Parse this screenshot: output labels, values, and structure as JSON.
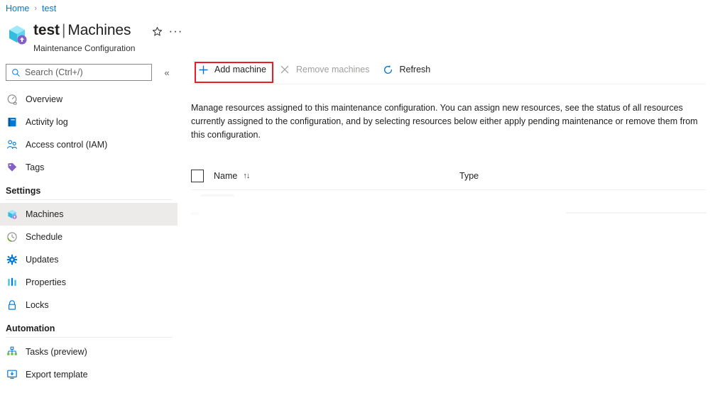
{
  "breadcrumb": {
    "items": [
      {
        "label": "Home"
      },
      {
        "label": "test"
      }
    ],
    "separator": "›"
  },
  "header": {
    "resource_icon": "maintenance-configuration-cube-icon",
    "resource_name": "test",
    "separator": "|",
    "section": "Machines",
    "subtitle": "Maintenance Configuration",
    "favorite_icon": "star-icon",
    "more_icon": "ellipsis-icon"
  },
  "sidebar": {
    "search": {
      "placeholder": "Search (Ctrl+/)",
      "value": "",
      "icon": "search-icon"
    },
    "collapse_icon": "«",
    "items": [
      {
        "label": "Overview",
        "icon": "overview-gauge-icon",
        "selected": false
      },
      {
        "label": "Activity log",
        "icon": "activity-log-icon",
        "selected": false
      },
      {
        "label": "Access control (IAM)",
        "icon": "access-control-icon",
        "selected": false
      },
      {
        "label": "Tags",
        "icon": "tag-icon",
        "selected": false
      }
    ],
    "groups": [
      {
        "title": "Settings",
        "items": [
          {
            "label": "Machines",
            "icon": "machines-cube-icon",
            "selected": true
          },
          {
            "label": "Schedule",
            "icon": "schedule-clock-icon",
            "selected": false
          },
          {
            "label": "Updates",
            "icon": "updates-gear-icon",
            "selected": false
          },
          {
            "label": "Properties",
            "icon": "properties-bars-icon",
            "selected": false
          },
          {
            "label": "Locks",
            "icon": "lock-icon",
            "selected": false
          }
        ]
      },
      {
        "title": "Automation",
        "items": [
          {
            "label": "Tasks (preview)",
            "icon": "tasks-tree-icon",
            "selected": false
          },
          {
            "label": "Export template",
            "icon": "export-template-icon",
            "selected": false
          }
        ]
      }
    ]
  },
  "toolbar": {
    "add_machine": {
      "label": "Add machine",
      "icon": "plus-icon",
      "disabled": false,
      "highlighted": true
    },
    "remove_machines": {
      "label": "Remove machines",
      "icon": "cross-icon",
      "disabled": true
    },
    "refresh": {
      "label": "Refresh",
      "icon": "refresh-icon",
      "disabled": false
    }
  },
  "main": {
    "description": "Manage resources assigned to this maintenance configuration. You can assign new resources, see the status of all resources currently assigned to the configuration, and by selecting resources below either apply pending maintenance or remove them from this configuration.",
    "table": {
      "select_all_checked": false,
      "columns": [
        {
          "label": "Name",
          "sortable": true,
          "sort_icon": "↑↓"
        },
        {
          "label": "Type",
          "sortable": false
        }
      ],
      "rows": []
    }
  },
  "colors": {
    "accent": "#0078d4",
    "highlight": "#ec1c24",
    "text": "#201f1e",
    "muted": "#605e5c",
    "disabled": "#a19f9d",
    "selected_bg": "#edebe9"
  }
}
